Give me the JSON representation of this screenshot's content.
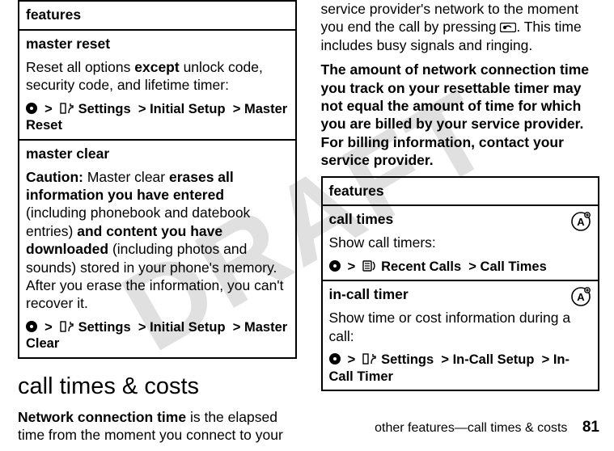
{
  "watermark": "DRAFT",
  "left": {
    "features_header": "features",
    "master_reset": {
      "title": "master reset",
      "body_pre": "Reset all options ",
      "body_bold1": "except",
      "body_post": " unlock code, security code, and lifetime timer:",
      "nav_settings": "Settings",
      "nav_initial": "Initial Setup",
      "nav_target": "Master Reset"
    },
    "master_clear": {
      "title": "master clear",
      "caution_label": "Caution:",
      "p1_a": " Master clear ",
      "p1_b": "erases all information you have entered",
      "p1_c": " (including phonebook and datebook entries) ",
      "p1_d": "and content you have downloaded",
      "p1_e": " (including photos and sounds) stored in your phone's memory. After you erase the information, you can't recover it.",
      "nav_settings": "Settings",
      "nav_initial": "Initial Setup",
      "nav_target": "Master Clear"
    },
    "section_title": "call times & costs",
    "para_bold": "Network connection time",
    "para_rest": " is the elapsed time from the moment you connect to your "
  },
  "right": {
    "para_top_a": "service provider's network to the moment you end the call by pressing ",
    "para_top_b": ". This time includes busy signals and ringing.",
    "para_bold": "The amount of network connection time you track on your resettable timer may not equal the amount of time for which you are billed by your service provider. For billing information, contact your service provider.",
    "features_header": "features",
    "call_times": {
      "title": "call times",
      "body": "Show call timers:",
      "nav_recent": "Recent Calls",
      "nav_target": "Call Times"
    },
    "incall": {
      "title": "in-call timer",
      "body": "Show time or cost information during a call:",
      "nav_settings": "Settings",
      "nav_incall": "In-Call Setup",
      "nav_target": "In-Call Timer"
    }
  },
  "footer": {
    "text": "other features—call times & costs",
    "page": "81"
  },
  "chev": ">"
}
